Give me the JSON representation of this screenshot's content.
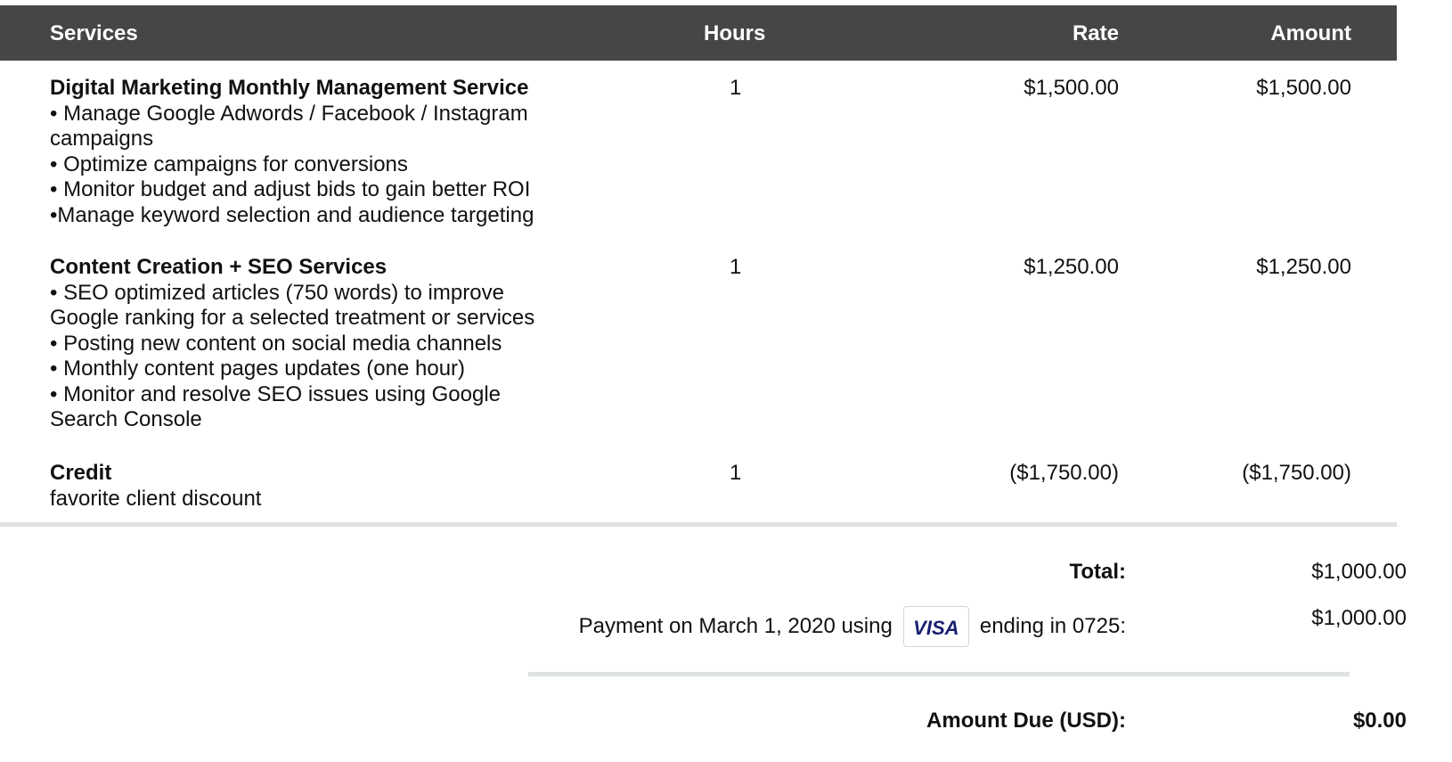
{
  "header": {
    "services": "Services",
    "hours": "Hours",
    "rate": "Rate",
    "amount": "Amount"
  },
  "items": [
    {
      "title": "Digital Marketing Monthly Management Service",
      "lines": [
        "• Manage Google Adwords / Facebook / Instagram",
        "campaigns",
        "• Optimize campaigns for conversions",
        "• Monitor budget and adjust bids to gain better ROI",
        "•Manage keyword selection and audience targeting"
      ],
      "hours": "1",
      "rate": "$1,500.00",
      "amount": "$1,500.00"
    },
    {
      "title": "Content Creation + SEO Services",
      "lines": [
        "• SEO optimized articles  (750 words) to improve",
        "Google ranking for a selected treatment or services",
        "• Posting new content on social media channels",
        "• Monthly content pages updates (one hour)",
        "• Monitor and resolve SEO issues using Google",
        "Search Console"
      ],
      "hours": "1",
      "rate": "$1,250.00",
      "amount": "$1,250.00"
    },
    {
      "title": "Credit",
      "lines": [
        "favorite client discount"
      ],
      "hours": "1",
      "rate": "($1,750.00)",
      "amount": "($1,750.00)"
    }
  ],
  "summary": {
    "total_label": "Total:",
    "total_value": "$1,000.00",
    "payment_prefix": "Payment on March 1, 2020 using",
    "card_brand": "VISA",
    "payment_suffix": "ending in 0725:",
    "payment_value": "$1,000.00",
    "due_label": "Amount Due (USD):",
    "due_value": "$0.00"
  }
}
